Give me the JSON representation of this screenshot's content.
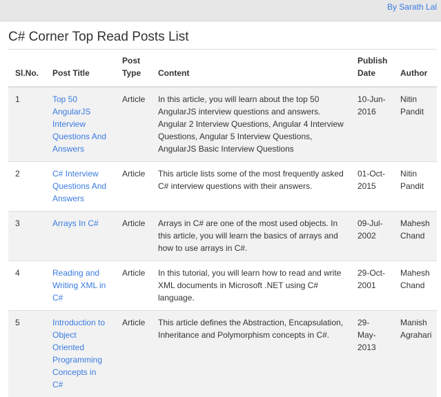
{
  "header": {
    "author_link": "By Sarath Lal"
  },
  "page_title": "C# Corner Top Read Posts List",
  "table": {
    "headers": [
      "Sl.No.",
      "Post Title",
      "Post Type",
      "Content",
      "Publish Date",
      "Author"
    ],
    "rows": [
      {
        "no": "1",
        "title": "Top 50 AngularJS Interview Questions And Answers",
        "type": "Article",
        "content": "In this article, you will learn about the top 50 AngularJS interview questions and answers. Angular 2 Interview Questions, Angular 4 Interview Questions, Angular 5 Interview Questions, AngularJS Basic Interview Questions",
        "date": "10-Jun-2016",
        "author": "Nitin Pandit"
      },
      {
        "no": "2",
        "title": "C# Interview Questions And Answers",
        "type": "Article",
        "content": "This article lists some of the most frequently asked C# interview questions with their answers.",
        "date": "01-Oct-2015",
        "author": "Nitin Pandit"
      },
      {
        "no": "3",
        "title": "Arrays In C#",
        "type": "Article",
        "content": "Arrays in C# are one of the most used objects. In this article, you will learn the basics of arrays and how to use arrays in C#.",
        "date": "09-Jul-2002",
        "author": "Mahesh Chand"
      },
      {
        "no": "4",
        "title": "Reading and Writing XML in C#",
        "type": "Article",
        "content": "In this tutorial, you will learn how to read and write XML documents in Microsoft .NET using C# language.",
        "date": "29-Oct-2001",
        "author": "Mahesh Chand"
      },
      {
        "no": "5",
        "title": "Introduction to Object Oriented Programming Concepts in C#",
        "type": "Article",
        "content": "This article defines the Abstraction, Encapsulation, Inheritance and Polymorphism concepts in C#.",
        "date": "29-May-2013",
        "author": "Manish Agrahari"
      }
    ]
  }
}
